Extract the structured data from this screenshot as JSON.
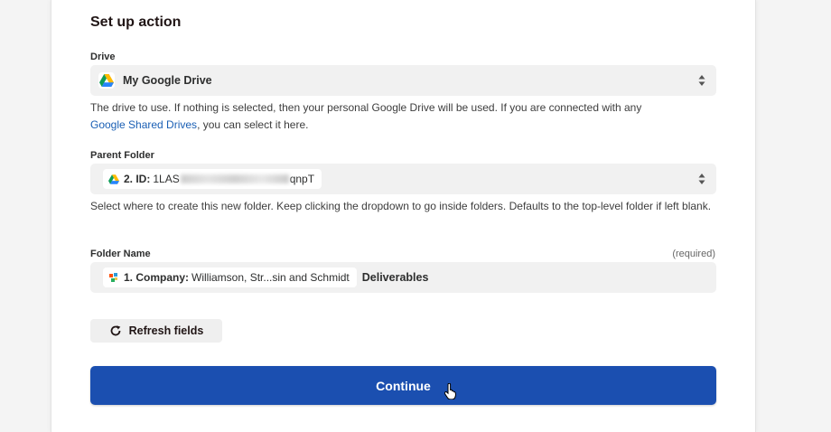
{
  "section_title": "Set up action",
  "drive": {
    "label": "Drive",
    "value": "My Google Drive",
    "icon": "google-drive-icon",
    "help_before_link": "The drive to use. If nothing is selected, then your personal Google Drive will be used. If you are connected with any",
    "help_link": "Google Shared Drives",
    "help_after_link": ", you can select it here."
  },
  "parent_folder": {
    "label": "Parent Folder",
    "pill_step": "2. ID:",
    "pill_prefix": "1LAS",
    "pill_suffix": "qnpT",
    "help": "Select where to create this new folder. Keep clicking the dropdown to go inside folders. Defaults to the top-level folder if left blank."
  },
  "folder_name": {
    "label": "Folder Name",
    "required": "(required)",
    "pill_step": "1. Company:",
    "pill_value": "Williamson, Str...sin and Schmidt",
    "trailing_text": "Deliverables"
  },
  "refresh_label": "Refresh fields",
  "continue_label": "Continue",
  "colors": {
    "primary": "#1b4fb0",
    "link": "#1a5fb4",
    "field_bg": "#f1f1f1"
  }
}
